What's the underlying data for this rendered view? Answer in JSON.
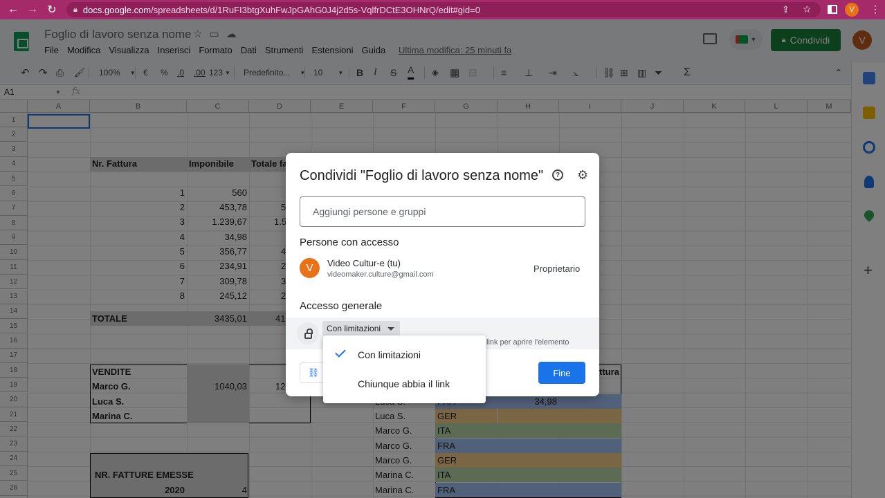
{
  "browser": {
    "url_host": "docs.google.com",
    "url_path": "/spreadsheets/d/1RuFI3btgXuhFwJpGAhG0J4j2d5s-VqlfrDCtE3OHNrQ/edit#gid=0",
    "profile_initial": "V"
  },
  "app": {
    "doc_title": "Foglio di lavoro senza nome",
    "menu": [
      "File",
      "Modifica",
      "Visualizza",
      "Inserisci",
      "Formato",
      "Dati",
      "Strumenti",
      "Estensioni",
      "Guida"
    ],
    "last_edit": "Ultima modifica: 25 minuti fa",
    "share_label": "Condividi",
    "avatar_initial": "V"
  },
  "toolbar": {
    "zoom": "100%",
    "currency": "€",
    "percent": "%",
    "dec_less": ".0",
    "dec_more": ".00",
    "num_format": "123",
    "font": "Predefinito...",
    "font_size": "10"
  },
  "formula": {
    "namebox": "A1",
    "fx": "fx"
  },
  "sheet": {
    "columns": [
      "A",
      "B",
      "C",
      "D",
      "E",
      "F",
      "G",
      "H",
      "I",
      "J",
      "K",
      "L",
      "M"
    ],
    "rows": [
      "1",
      "2",
      "3",
      "4",
      "5",
      "6",
      "7",
      "8",
      "9",
      "10",
      "11",
      "12",
      "13",
      "14",
      "15",
      "16",
      "17",
      "18",
      "19",
      "20",
      "21",
      "22",
      "23",
      "24",
      "25",
      "26",
      "27"
    ],
    "headers": {
      "b4": "Nr. Fattura",
      "c4": "Imponibile",
      "d4": "Totale fa"
    },
    "invoice_nums": [
      "1",
      "2",
      "3",
      "4",
      "5",
      "6",
      "7",
      "8"
    ],
    "imponibile": [
      "560",
      "453,78",
      "1.239,67",
      "34,98",
      "356,77",
      "234,91",
      "309,78",
      "245,12"
    ],
    "totale_partial": [
      "",
      "5",
      "1.5",
      "",
      "4",
      "2",
      "3",
      "2"
    ],
    "totale_label": "TOTALE",
    "totale_c": "3435,01",
    "totale_d": "41",
    "vendite_label": "VENDITE",
    "sellers": [
      "Marco G.",
      "Luca S.",
      "Marina C."
    ],
    "marco_c": "1040,03",
    "marco_d": "12",
    "emesse_label": "NR. FATTURE EMESSE",
    "year": "2020",
    "year_val": "4",
    "right_header_tail": "ttura",
    "right_names": [
      "Luca S.",
      "Luca S.",
      "Marco G.",
      "Marco G.",
      "Marco G.",
      "Marina C.",
      "Marina C."
    ],
    "right_countries": [
      "FRA",
      "GER",
      "ITA",
      "FRA",
      "GER",
      "ITA",
      "FRA"
    ],
    "right_h21": "34,98"
  },
  "dialog": {
    "title": "Condividi \"Foglio di lavoro senza nome\"",
    "add_placeholder": "Aggiungi persone e gruppi",
    "people_label": "Persone con accesso",
    "person_initial": "V",
    "person_name": "Video Cultur-e (tu)",
    "person_email": "videomaker.culture@gmail.com",
    "person_role": "Proprietario",
    "general_label": "Accesso generale",
    "access_value": "Con limitazioni",
    "access_desc": "link per aprire l'elemento",
    "done_label": "Fine"
  },
  "access_menu": {
    "options": [
      "Con limitazioni",
      "Chiunque abbia il link"
    ],
    "selected": "Con limitazioni"
  },
  "colors": {
    "browser_bar": "#a52a6a",
    "share_button": "#188038",
    "primary_blue": "#1a73e8",
    "avatar_orange": "#e8711a"
  }
}
